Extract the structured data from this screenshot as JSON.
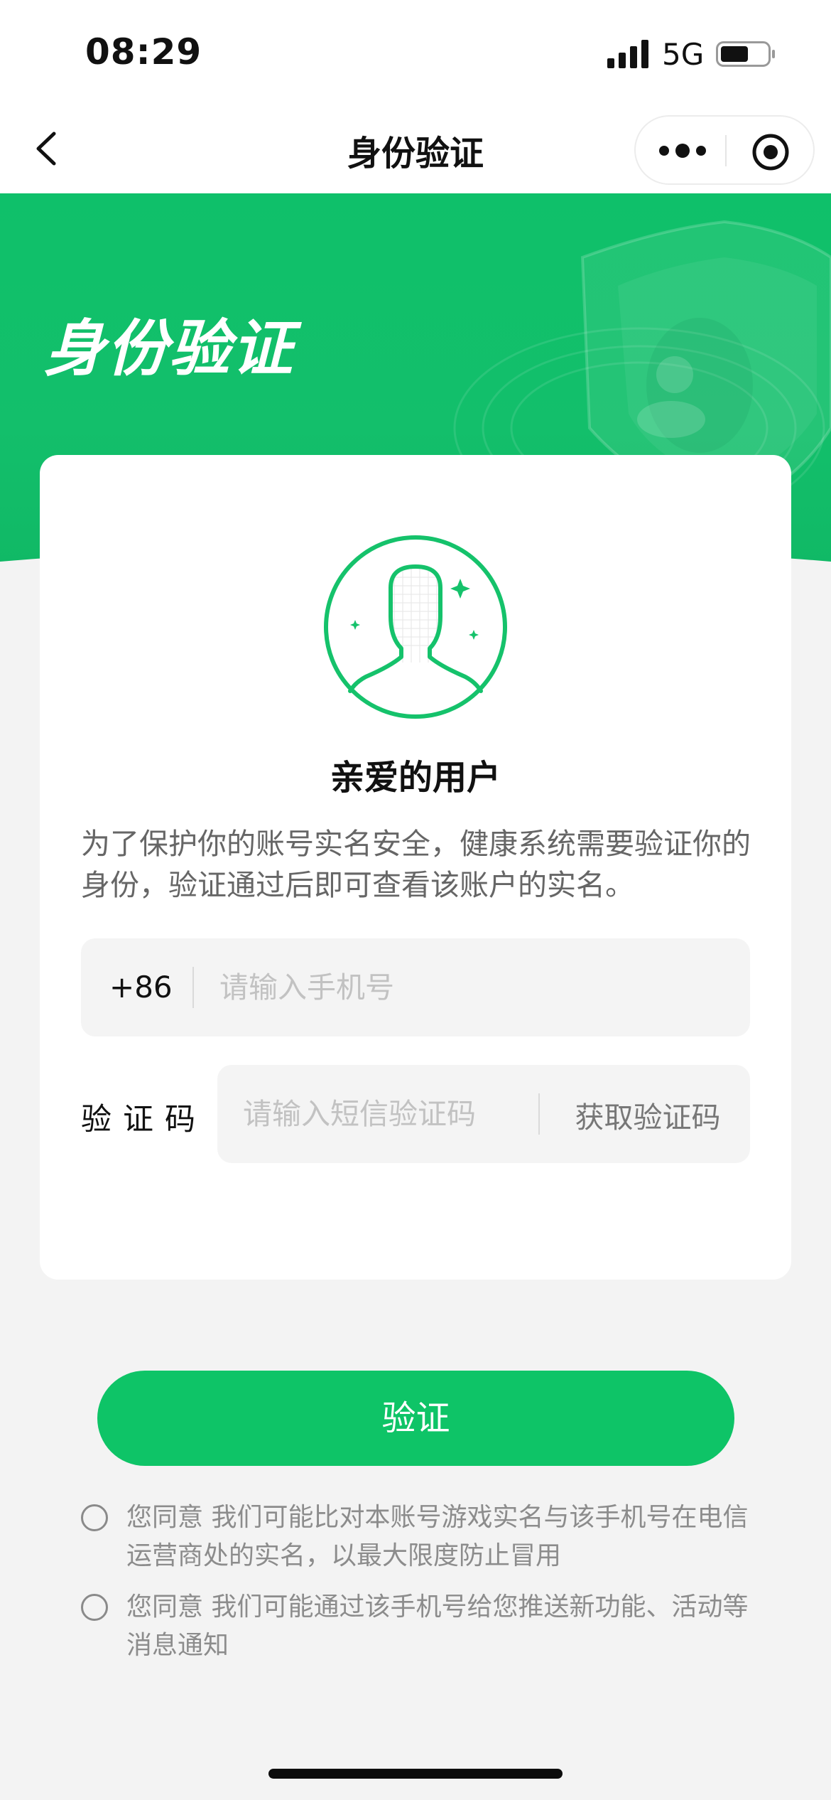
{
  "status_bar": {
    "time": "08:29",
    "network": "5G",
    "signal_bars": 4,
    "battery_level": 0.6
  },
  "nav": {
    "title": "身份验证",
    "back_icon": "chevron-left-icon",
    "more_icon": "more-dots-icon",
    "target_icon": "target-icon"
  },
  "banner": {
    "title": "身份验证",
    "decoration_icon": "shield-user-icon"
  },
  "card": {
    "avatar_icon": "user-avatar-icon",
    "greeting": "亲爱的用户",
    "description": "为了保护你的账号实名安全，健康系统需要验证你的身份，验证通过后即可查看该账户的实名。",
    "phone": {
      "country_code": "+86",
      "placeholder": "请输入手机号",
      "value": ""
    },
    "code": {
      "label": "验证码",
      "placeholder": "请输入短信验证码",
      "value": "",
      "get_code_label": "获取验证码"
    }
  },
  "verify_button": {
    "label": "验证"
  },
  "consents": [
    {
      "text": "您同意 我们可能比对本账号游戏实名与该手机号在电信运营商处的实名，以最大限度防止冒用",
      "checked": false
    },
    {
      "text": "您同意 我们可能通过该手机号给您推送新功能、活动等消息通知",
      "checked": false
    }
  ],
  "colors": {
    "brand_green": "#0ec467",
    "background": "#f3f3f3",
    "card": "#ffffff"
  }
}
